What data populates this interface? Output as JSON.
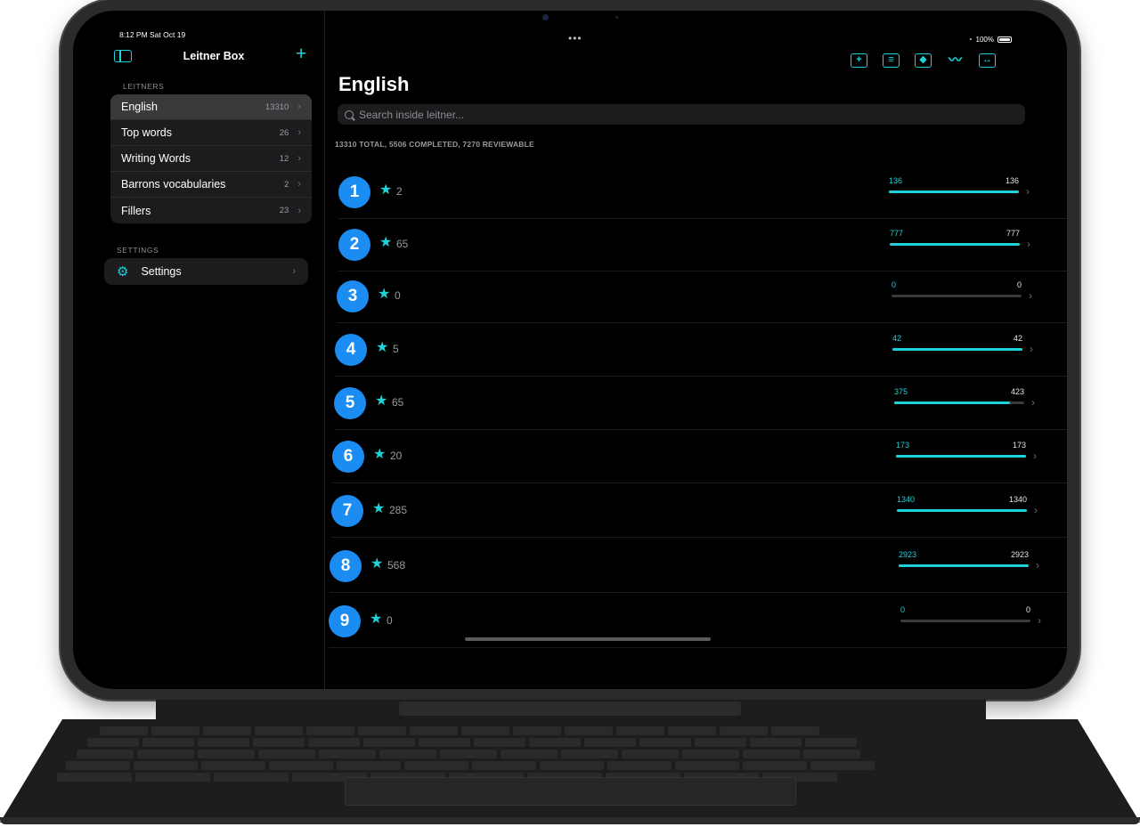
{
  "status": {
    "time": "8:12 PM  Sat Oct 19",
    "battery": "100%"
  },
  "sidebar": {
    "title": "Leitner Box",
    "leitners_header": "LEITNERS",
    "items": [
      {
        "label": "English",
        "count": "13310",
        "selected": true
      },
      {
        "label": "Top words",
        "count": "26"
      },
      {
        "label": "Writing Words",
        "count": "12"
      },
      {
        "label": "Barrons vocabularies",
        "count": "2"
      },
      {
        "label": "Fillers",
        "count": "23"
      }
    ],
    "settings_header": "SETTINGS",
    "settings_label": "Settings"
  },
  "main": {
    "title": "English",
    "search_placeholder": "Search inside leitner...",
    "summary": "13310 TOTAL, 5506 COMPLETED, 7270 REVIEWABLE",
    "toolbar": [
      "add-icon",
      "list-card-icon",
      "tag-icon",
      "chart-line-icon",
      "swap-icon"
    ],
    "boxes": [
      {
        "level": "1",
        "stars": "2",
        "reviewable": "136",
        "total": "136",
        "progress": 1.0
      },
      {
        "level": "2",
        "stars": "65",
        "reviewable": "777",
        "total": "777",
        "progress": 1.0
      },
      {
        "level": "3",
        "stars": "0",
        "reviewable": "0",
        "total": "0",
        "progress": 0.0
      },
      {
        "level": "4",
        "stars": "5",
        "reviewable": "42",
        "total": "42",
        "progress": 1.0
      },
      {
        "level": "5",
        "stars": "65",
        "reviewable": "375",
        "total": "423",
        "progress": 0.887
      },
      {
        "level": "6",
        "stars": "20",
        "reviewable": "173",
        "total": "173",
        "progress": 1.0
      },
      {
        "level": "7",
        "stars": "285",
        "reviewable": "1340",
        "total": "1340",
        "progress": 1.0
      },
      {
        "level": "8",
        "stars": "568",
        "reviewable": "2923",
        "total": "2923",
        "progress": 1.0
      },
      {
        "level": "9",
        "stars": "0",
        "reviewable": "0",
        "total": "0",
        "progress": 0.0
      }
    ]
  },
  "colors": {
    "accent": "#1fd1d8",
    "badge": "#1a8cf2",
    "background": "#000000"
  }
}
